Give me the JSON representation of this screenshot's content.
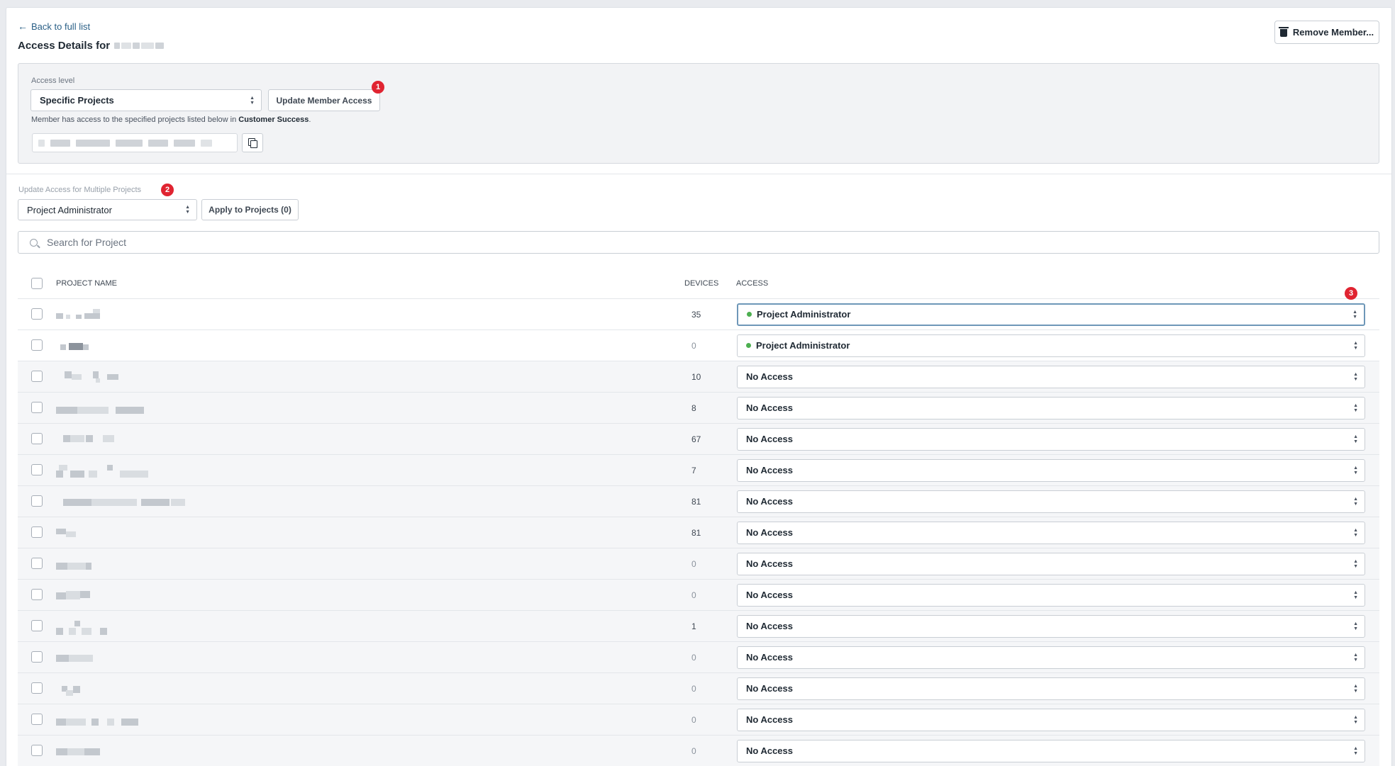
{
  "header": {
    "back_label": "Back to full list",
    "title_prefix": "Access Details for",
    "remove_label": "Remove Member..."
  },
  "access_box": {
    "label": "Access level",
    "selected_level": "Specific Projects",
    "update_label": "Update Member Access",
    "badge_1": "1",
    "desc_prefix": "Member has access to the specified projects listed below in",
    "desc_org": "Customer Success",
    "desc_suffix": "."
  },
  "multi": {
    "label": "Update Access for Multiple Projects",
    "badge_2": "2",
    "selected_role": "Project Administrator",
    "apply_label": "Apply to Projects (0)"
  },
  "search": {
    "placeholder": "Search for Project"
  },
  "table": {
    "col_name": "Project Name",
    "col_devices": "Devices",
    "col_access": "Access",
    "badge_3": "3",
    "rows": [
      {
        "devices": "35",
        "access": "Project Administrator"
      },
      {
        "devices": "0",
        "access": "Project Administrator"
      },
      {
        "devices": "10",
        "access": "No Access"
      },
      {
        "devices": "8",
        "access": "No Access"
      },
      {
        "devices": "67",
        "access": "No Access"
      },
      {
        "devices": "7",
        "access": "No Access"
      },
      {
        "devices": "81",
        "access": "No Access"
      },
      {
        "devices": "81",
        "access": "No Access"
      },
      {
        "devices": "0",
        "access": "No Access"
      },
      {
        "devices": "0",
        "access": "No Access"
      },
      {
        "devices": "1",
        "access": "No Access"
      },
      {
        "devices": "0",
        "access": "No Access"
      },
      {
        "devices": "0",
        "access": "No Access"
      },
      {
        "devices": "0",
        "access": "No Access"
      },
      {
        "devices": "0",
        "access": "No Access"
      }
    ]
  },
  "colors": {
    "badge": "#e02431",
    "admin_dot": "#4caf50",
    "link": "#2a5f86",
    "focus_border": "#6e97b8"
  }
}
